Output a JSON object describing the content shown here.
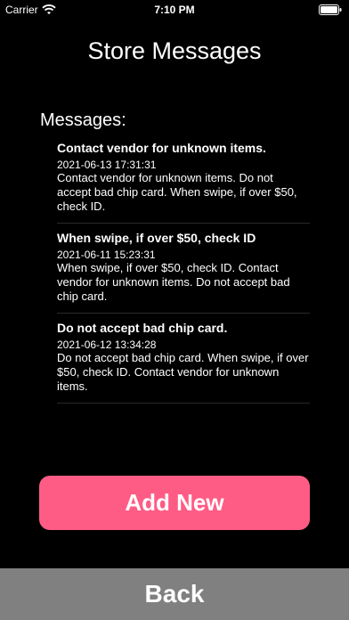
{
  "status_bar": {
    "carrier": "Carrier",
    "time": "7:10 PM"
  },
  "header": {
    "title": "Store Messages"
  },
  "messages_section": {
    "label": "Messages:"
  },
  "messages": [
    {
      "title": "Contact vendor for unknown items.",
      "date": "2021-06-13 17:31:31",
      "body": "Contact vendor for unknown items. Do not accept bad chip card. When swipe, if over $50, check ID."
    },
    {
      "title": "When swipe, if over $50, check ID",
      "date": "2021-06-11 15:23:31",
      "body": "When swipe, if over $50, check ID. Contact vendor for unknown items. Do not accept bad chip card."
    },
    {
      "title": "Do not accept bad chip card.",
      "date": "2021-06-12 13:34:28",
      "body": "Do not accept bad chip card. When swipe, if over $50, check ID. Contact vendor for unknown items."
    }
  ],
  "actions": {
    "add_new_label": "Add New",
    "back_label": "Back"
  },
  "colors": {
    "background": "#000000",
    "accent": "#ff5c85",
    "back_bar": "#808080"
  }
}
